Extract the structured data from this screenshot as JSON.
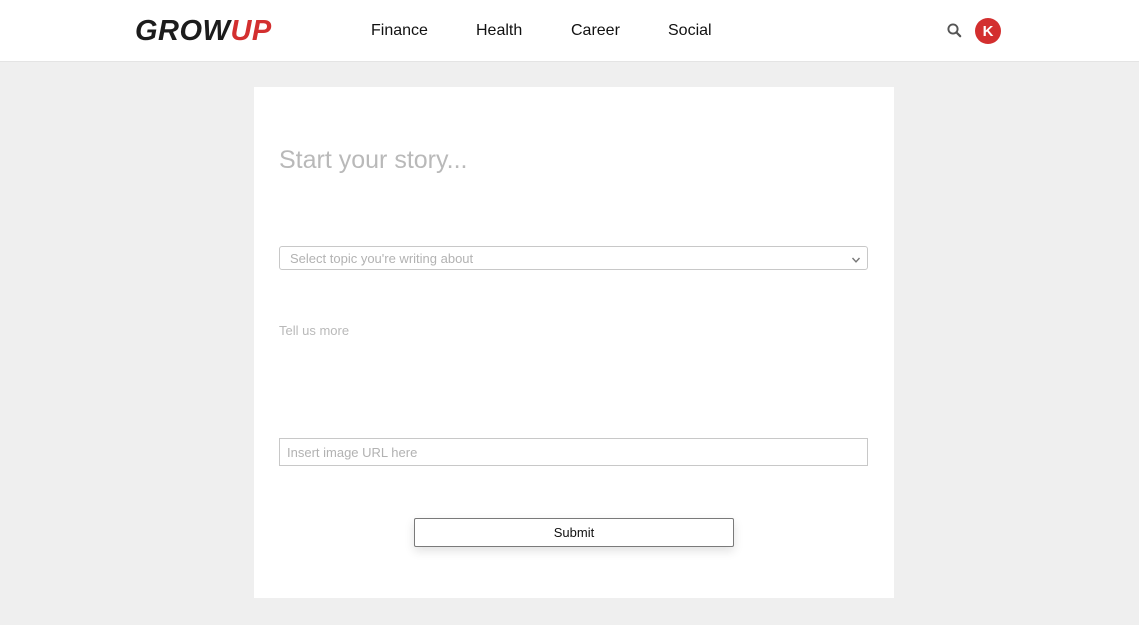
{
  "header": {
    "logo_part1": "GROW",
    "logo_part2": "UP",
    "nav": [
      {
        "label": "Finance"
      },
      {
        "label": "Health"
      },
      {
        "label": "Career"
      },
      {
        "label": "Social"
      }
    ],
    "search_icon": "search-icon",
    "avatar_initial": "K",
    "brand_color": "#d32f2f"
  },
  "form": {
    "title_placeholder": "Start your story...",
    "title_value": "",
    "topic_placeholder": "Select topic you're writing about",
    "description_placeholder": "Tell us more",
    "description_value": "",
    "image_url_placeholder": "Insert image URL here",
    "image_url_value": "",
    "submit_label": "Submit"
  }
}
